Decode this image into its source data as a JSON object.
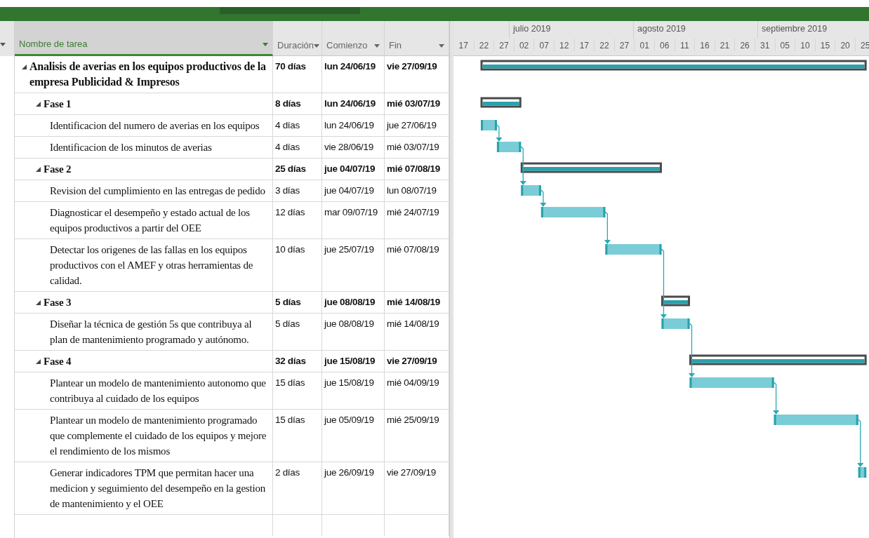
{
  "columns": [
    {
      "label": "Nombre de tarea",
      "selected": true
    },
    {
      "label": "Duración",
      "selected": false
    },
    {
      "label": "Comienzo",
      "selected": false
    },
    {
      "label": "Fin",
      "selected": false
    }
  ],
  "timescale": {
    "months": [
      "julio 2019",
      "agosto 2019",
      "septiembre 2019"
    ],
    "days": [
      "17",
      "22",
      "27",
      "02",
      "07",
      "12",
      "17",
      "22",
      "27",
      "01",
      "06",
      "11",
      "16",
      "21",
      "26",
      "31",
      "05",
      "10",
      "15",
      "20",
      "25"
    ]
  },
  "tasks": [
    {
      "kind": "project",
      "name": "Analisis de averias en los equipos productivos de la empresa Publicidad & Impresos",
      "duration": "70 días",
      "start": "lun 24/06/19",
      "finish": "vie 27/09/19",
      "expanded": true,
      "children": [
        {
          "kind": "summary",
          "name": "Fase 1",
          "duration": "8 días",
          "start": "lun 24/06/19",
          "finish": "mié 03/07/19",
          "expanded": true,
          "children": [
            {
              "kind": "task",
              "name": "Identificacion del numero de averias en los equipos",
              "duration": "4 días",
              "start": "lun 24/06/19",
              "finish": "jue 27/06/19"
            },
            {
              "kind": "task",
              "name": "Identificacion de los minutos de averias",
              "duration": "4 días",
              "start": "vie 28/06/19",
              "finish": "mié 03/07/19"
            }
          ]
        },
        {
          "kind": "summary",
          "name": "Fase 2",
          "duration": "25 días",
          "start": "jue 04/07/19",
          "finish": "mié 07/08/19",
          "expanded": true,
          "children": [
            {
              "kind": "task",
              "name": "Revision del cumplimiento en las entregas de pedido",
              "duration": "3 días",
              "start": "jue 04/07/19",
              "finish": "lun 08/07/19"
            },
            {
              "kind": "task",
              "name": "Diagnosticar el desempeño y estado actual de los equipos productivos a partir del OEE",
              "duration": "12 días",
              "start": "mar 09/07/19",
              "finish": "mié 24/07/19"
            },
            {
              "kind": "task",
              "name": "Detectar los origenes de las fallas en los equipos productivos con el AMEF y otras herramientas de calidad.",
              "duration": "10 días",
              "start": "jue 25/07/19",
              "finish": "mié 07/08/19"
            }
          ]
        },
        {
          "kind": "summary",
          "name": "Fase 3",
          "duration": "5 días",
          "start": "jue 08/08/19",
          "finish": "mié 14/08/19",
          "expanded": true,
          "children": [
            {
              "kind": "task",
              "name": "Diseñar la técnica de gestión 5s que contribuya al plan de mantenimiento programado y autónomo.",
              "duration": "5 días",
              "start": "jue 08/08/19",
              "finish": "mié 14/08/19"
            }
          ]
        },
        {
          "kind": "summary",
          "name": "Fase 4",
          "duration": "32 días",
          "start": "jue 15/08/19",
          "finish": "vie 27/09/19",
          "expanded": true,
          "children": [
            {
              "kind": "task",
              "name": "Plantear un modelo de mantenimiento autonomo que contribuya al cuidado de los equipos",
              "duration": "15 días",
              "start": "jue 15/08/19",
              "finish": "mié 04/09/19"
            },
            {
              "kind": "task",
              "name": "Plantear un modelo de mantenimiento programado que complemente el cuidado de los equipos y mejore el rendimiento de los mismos",
              "duration": "15 días",
              "start": "jue 05/09/19",
              "finish": "mié 25/09/19"
            },
            {
              "kind": "task",
              "name": "Generar indicadores TPM que permitan hacer una medicion y seguimiento del desempeño en la gestion de mantenimiento y el OEE",
              "duration": "2 días",
              "start": "jue 26/09/19",
              "finish": "vie 27/09/19"
            }
          ]
        }
      ]
    }
  ]
}
